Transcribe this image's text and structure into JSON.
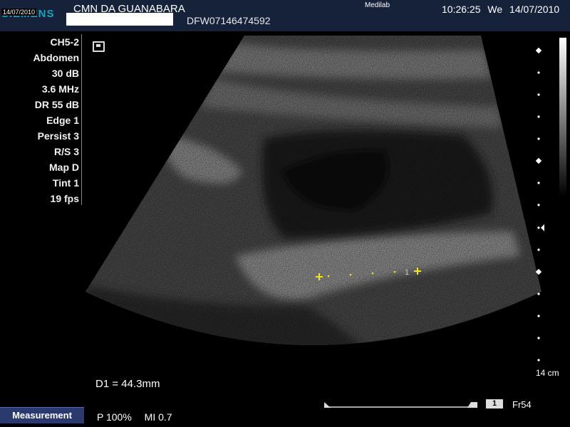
{
  "header": {
    "logo_text": "SIEMENS",
    "logo_date": "14/07/2010",
    "institution": "CMN DA GUANABARA",
    "patient_id": "DFW07146474592",
    "site": "Medilab",
    "time": "10:26:25",
    "weekday": "We",
    "date": "14/07/2010"
  },
  "params": [
    "CH5-2",
    "Abdomen",
    "30 dB",
    "3.6 MHz",
    "DR 55 dB",
    "Edge 1",
    "Persist 3",
    "R/S 3",
    "Map D",
    "Tint 1",
    "19 fps"
  ],
  "measurement": {
    "result": "D1 = 44.3mm",
    "caliper_label": "1",
    "button_label": "Measurement"
  },
  "footer": {
    "power": "P 100%",
    "mi": "MI 0.7",
    "cine_index": "1",
    "frame": "Fr54",
    "depth": "14 cm"
  },
  "colors": {
    "caliper": "#f2e31b",
    "header_bg": "#16213a",
    "logo": "#1aa3b8"
  }
}
